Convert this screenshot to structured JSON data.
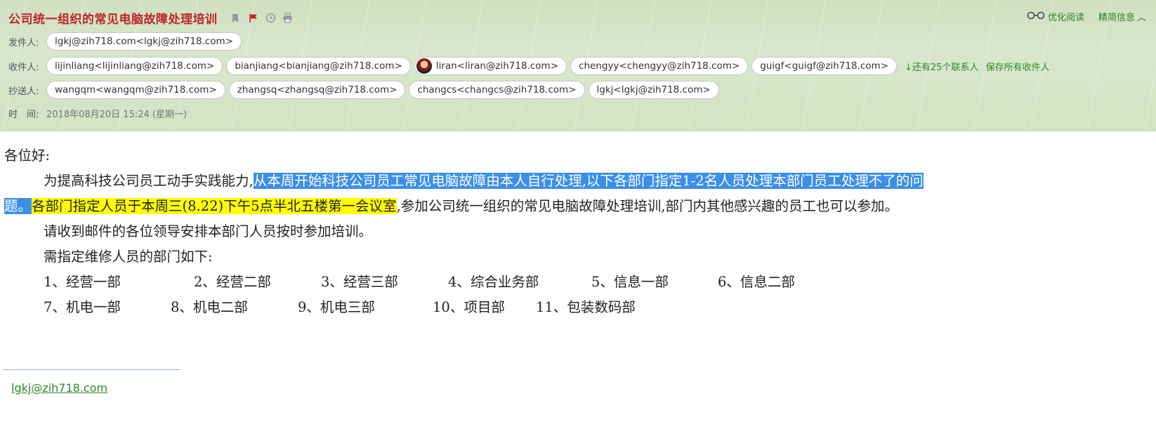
{
  "email": {
    "subject": "公司统一组织的常见电脑故障处理培训",
    "tools": {
      "optimize_read": "优化阅读",
      "concise_info": "精简信息"
    },
    "from_label": "发件人:",
    "from": "lgkj@zih718.com<lgkj@zih718.com>",
    "to_label": "收件人:",
    "to": [
      "lijinliang<lijinliang@zih718.com>",
      "bianjiang<bianjiang@zih718.com>",
      "liran<liran@zih718.com>",
      "chengyy<chengyy@zih718.com>",
      "guigf<guigf@zih718.com>"
    ],
    "more_contacts": "↓还有25个联系人",
    "save_all": "保存所有收件人",
    "cc_label": "抄送人:",
    "cc": [
      "wangqm<wangqm@zih718.com>",
      "zhangsq<zhangsq@zih718.com>",
      "changcs<changcs@zih718.com>",
      "lgkj<lgkj@zih718.com>"
    ],
    "time_label": "时　间:",
    "time": "2018年08月20日 15:24 (星期一)"
  },
  "body": {
    "greeting": "各位好:",
    "p1_a": "为提高科技公司员工动手实践能力,",
    "p1_sel1": "从本周开始科技公司员工常见电脑故障由本人自行处理,以下各部门指定1-2名人员处理本部门员工处理不了的问",
    "p1_sel2": "题。",
    "p1_hl": "各部门指定人员于本周三(8.22)下午5点半北五楼第一会议室",
    "p1_b": ",参加公司统一组织的常见电脑故障处理培训,部门内其他感兴趣的员工也可以参加。",
    "p2": "请收到邮件的各位领导安排本部门人员按时参加培训。",
    "p3": "需指定维修人员的部门如下:",
    "depts_row1": [
      "1、经营一部",
      "2、经营二部",
      "3、经营三部",
      "4、综合业务部",
      "5、信息一部",
      "6、信息二部"
    ],
    "depts_row2": [
      "7、机电一部",
      "8、机电二部",
      "9、机电三部",
      "10、项目部",
      "11、包装数码部"
    ]
  },
  "signature": "lgkj@zih718.com"
}
